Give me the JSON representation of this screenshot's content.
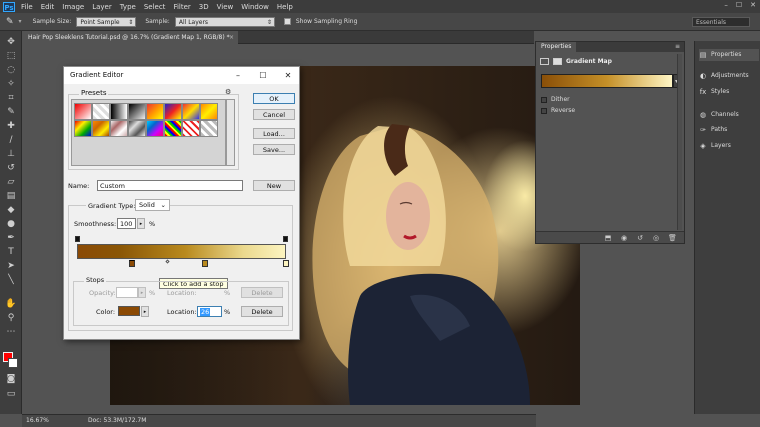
{
  "app": {
    "logo": "Ps",
    "menus": [
      "File",
      "Edit",
      "Image",
      "Layer",
      "Type",
      "Select",
      "Filter",
      "3D",
      "View",
      "Window",
      "Help"
    ],
    "window_controls": [
      "–",
      "☐",
      "✕"
    ]
  },
  "options": {
    "sample_size_label": "Sample Size:",
    "sample_size_value": "Point Sample",
    "sample_label": "Sample:",
    "sample_value": "All Layers",
    "show_sampling_ring": "Show Sampling Ring",
    "workspace": "Essentials"
  },
  "document": {
    "tab_title": "Hair Pop Sleeklens Tutorial.psd @ 16.7% (Gradient Map 1, RGB/8) *",
    "close": "×"
  },
  "status": {
    "zoom": "16.67%",
    "doc_size": "Doc: 53.3M/172.7M"
  },
  "properties": {
    "tab": "Properties",
    "heading": "Gradient Map",
    "dither": "Dither",
    "reverse": "Reverse"
  },
  "dock": {
    "items": [
      "Properties",
      "Adjustments",
      "Styles",
      "Channels",
      "Paths",
      "Layers"
    ]
  },
  "dialog": {
    "title": "Gradient Editor",
    "presets_label": "Presets",
    "ok": "OK",
    "cancel": "Cancel",
    "load": "Load...",
    "save": "Save...",
    "name_label": "Name:",
    "name_value": "Custom",
    "new_button": "New",
    "gradient_type_label": "Gradient Type:",
    "gradient_type_value": "Solid",
    "smoothness_label": "Smoothness:",
    "smoothness_value": "100",
    "percent": "%",
    "tooltip": "Click to add a stop",
    "stops_label": "Stops",
    "opacity_label": "Opacity:",
    "opacity_location_label": "Location:",
    "delete_disabled": "Delete",
    "color_label": "Color:",
    "location_label": "Location:",
    "location_value": "26",
    "delete": "Delete",
    "stop_color": "#8b4a04"
  },
  "colors": {
    "foreground": "#ff0000",
    "background": "#ffffff",
    "gradient_start": "#8a4a06",
    "gradient_end": "#fcf4c0"
  }
}
